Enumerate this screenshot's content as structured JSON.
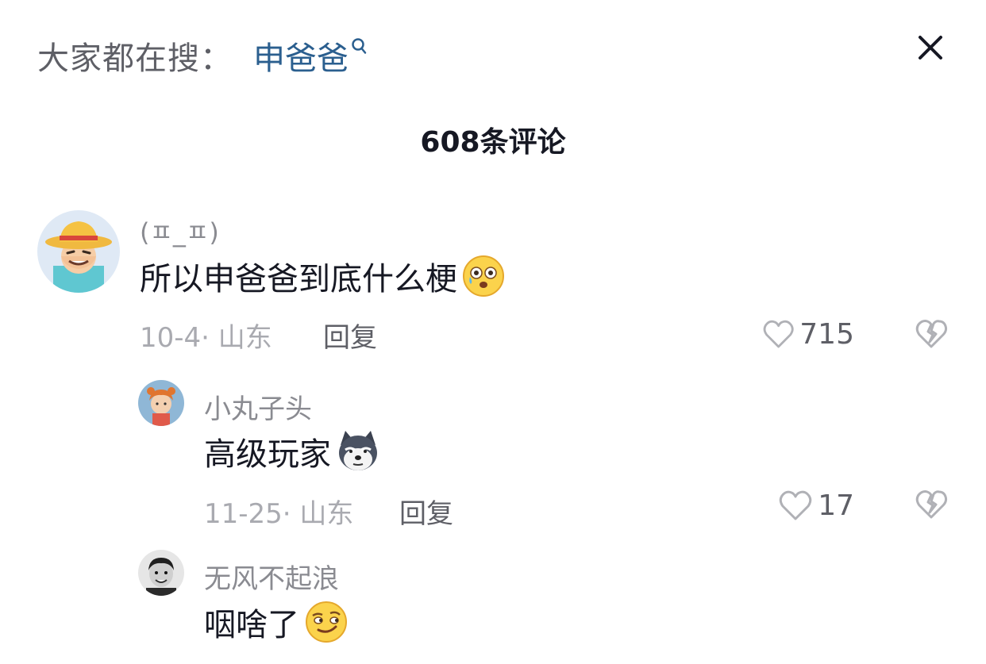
{
  "header": {
    "search_prefix": "大家都在搜：",
    "search_term": "申爸爸",
    "comment_count": "608条评论"
  },
  "comments": [
    {
      "username": "(ㅍ_ㅍ)",
      "text": "所以申爸爸到底什么梗",
      "emoji": "flushed-tear-emoji",
      "date": "10-4",
      "location": "山东",
      "reply_label": "回复",
      "likes": "715",
      "replies": [
        {
          "username": "小丸子头",
          "text": "高级玩家",
          "emoji": "doge-emoji",
          "date": "11-25",
          "location": "山东",
          "reply_label": "回复",
          "likes": "17"
        },
        {
          "username": "无风不起浪",
          "text": "咽啥了",
          "emoji": "smirk-emoji"
        }
      ]
    }
  ],
  "icons": {
    "close": "close-icon",
    "like": "heart-outline-icon",
    "dislike": "broken-heart-icon",
    "search": "search-icon"
  },
  "colors": {
    "search_term": "#2b5f8f",
    "primary_text": "#161823",
    "secondary_text": "#8a8b91",
    "meta_text": "#a9aab0"
  }
}
